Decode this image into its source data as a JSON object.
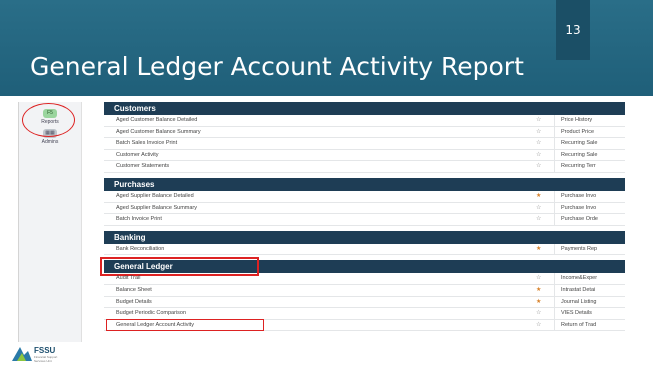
{
  "slide": {
    "title": "General Ledger Account Activity Report",
    "number": "13"
  },
  "nav": [
    {
      "icon_text": "F5",
      "label": "Reports"
    },
    {
      "icon_text": "",
      "label": "Admins"
    }
  ],
  "sections": [
    {
      "title": "Customers",
      "rows": [
        {
          "label": "Aged Customer Balance Detailed",
          "star": "gray",
          "right": "Price History"
        },
        {
          "label": "Aged Customer Balance Summary",
          "star": "gray",
          "right": "Product Price"
        },
        {
          "label": "Batch Sales Invoice Print",
          "star": "gray",
          "right": "Recurring Sale"
        },
        {
          "label": "Customer Activity",
          "star": "gray",
          "right": "Recurring Sale"
        },
        {
          "label": "Customer Statements",
          "star": "gray",
          "right": "Recurring Terr"
        }
      ]
    },
    {
      "title": "Purchases",
      "rows": [
        {
          "label": "Aged Supplier Balance Detailed",
          "star": "orange",
          "right": "Purchase Invo"
        },
        {
          "label": "Aged Supplier Balance Summary",
          "star": "gray",
          "right": "Purchase Invo"
        },
        {
          "label": "Batch Invoice Print",
          "star": "gray",
          "right": "Purchase Orde"
        }
      ]
    },
    {
      "title": "Banking",
      "rows": [
        {
          "label": "Bank Reconciliation",
          "star": "orange",
          "right": "Payments Rep"
        }
      ]
    },
    {
      "title": "General Ledger",
      "rows": [
        {
          "label": "Audit Trail",
          "star": "gray",
          "right": "Income&Exper"
        },
        {
          "label": "Balance Sheet",
          "star": "orange",
          "right": "Intrastat Detai"
        },
        {
          "label": "Budget Details",
          "star": "orange",
          "right": "Journal Listing"
        },
        {
          "label": "Budget Periodic Comparison",
          "star": "gray",
          "right": "VIES Details"
        },
        {
          "label": "General Ledger Account Activity",
          "star": "gray",
          "right": "Return of Trad"
        }
      ]
    }
  ],
  "logo": {
    "text": "FSSU",
    "sub": "Financial Support Services Unit"
  },
  "colors": {
    "banner": "#1f5f79",
    "section_header": "#1e3d55",
    "highlight": "#dd2222",
    "star_orange": "#d8822a"
  }
}
